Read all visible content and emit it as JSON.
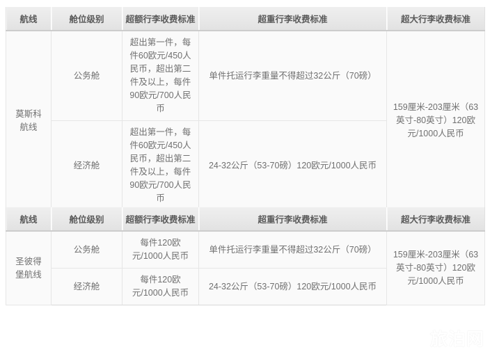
{
  "columns": {
    "route": "航线",
    "cabin": "舱位级别",
    "excess": "超额行李收费标准",
    "overweight": "超重行李收费标准",
    "oversize": "超大行李收费标准"
  },
  "tables": [
    {
      "id": "moscow",
      "header": {
        "route": "航线",
        "cabin": "舱位级别",
        "excess": "超额行李收费标准",
        "overweight": "超重行李收费标准",
        "oversize": "超大行李收费标准"
      },
      "route_label": "莫斯科航线",
      "oversize_value": "159厘米-203厘米（63英寸-80英寸）120欧元/1000人民币",
      "rows": [
        {
          "cabin": "公务舱",
          "excess": "超出第一件，每件60欧元/450人民币，超出第二件及以上，每件90欧元/700人民币",
          "overweight": "单件托运行李重量不得超过32公斤（70磅）"
        },
        {
          "cabin": "经济舱",
          "excess": "超出第一件，每件60欧元/450人民币，超出第二件及以上，每件90欧元/700人民币",
          "overweight": "24-32公斤（53-70磅）120欧元/1000人民币"
        }
      ]
    },
    {
      "id": "stpetersburg",
      "header": {
        "route": "航线",
        "cabin": "舱位级别",
        "excess": "超额行李收费标准",
        "overweight": "超重行李收费标准",
        "oversize": "超大行李收费标准"
      },
      "route_label": "圣彼得堡航线",
      "oversize_value": "159厘米-203厘米（63英寸-80英寸）120欧元/1000人民币",
      "rows": [
        {
          "cabin": "公务舱",
          "excess": "每件120欧元/1000人民币",
          "overweight": "单件托运行李重量不得超过32公斤（70磅）"
        },
        {
          "cabin": "经济舱",
          "excess": "每件120欧元/1000人民币",
          "overweight": "24-32公斤（53-70磅）120欧元/1000人民币"
        }
      ]
    }
  ],
  "watermark": {
    "text": "旅泊网",
    "color": "#ffffff"
  }
}
